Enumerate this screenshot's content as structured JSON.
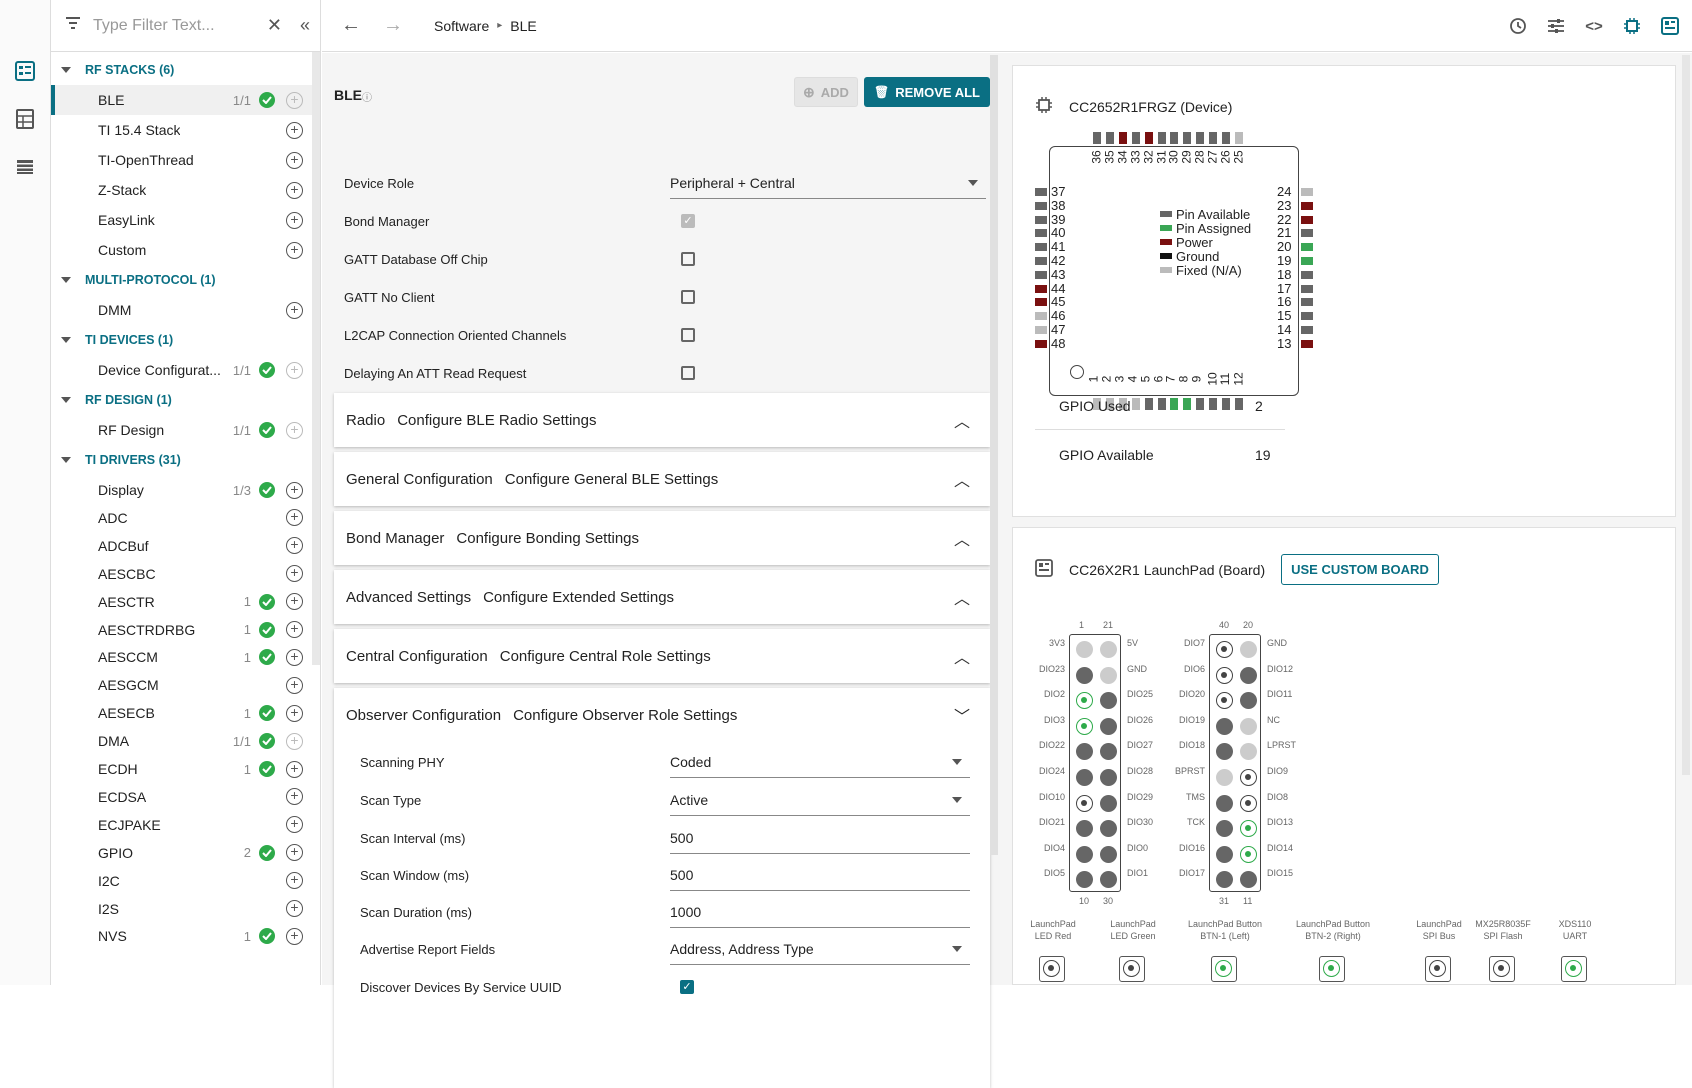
{
  "filter": {
    "placeholder": "Type Filter Text..."
  },
  "sidebar": {
    "categories": [
      {
        "label": "RF STACKS (6)"
      },
      {
        "label": "MULTI-PROTOCOL (1)"
      },
      {
        "label": "TI DEVICES (1)"
      },
      {
        "label": "RF DESIGN (1)"
      },
      {
        "label": "TI DRIVERS (31)"
      }
    ],
    "items": [
      {
        "label": "BLE",
        "count": "1/1"
      },
      {
        "label": "TI 15.4 Stack",
        "count": ""
      },
      {
        "label": "TI-OpenThread",
        "count": ""
      },
      {
        "label": "Z-Stack",
        "count": ""
      },
      {
        "label": "EasyLink",
        "count": ""
      },
      {
        "label": "Custom",
        "count": ""
      },
      {
        "label": "DMM",
        "count": ""
      },
      {
        "label": "Device Configurat...",
        "count": "1/1"
      },
      {
        "label": "RF Design",
        "count": "1/1"
      },
      {
        "label": "Display",
        "count": "1/3"
      },
      {
        "label": "ADC",
        "count": ""
      },
      {
        "label": "ADCBuf",
        "count": ""
      },
      {
        "label": "AESCBC",
        "count": ""
      },
      {
        "label": "AESCTR",
        "count": "1"
      },
      {
        "label": "AESCTRDRBG",
        "count": "1"
      },
      {
        "label": "AESCCM",
        "count": "1"
      },
      {
        "label": "AESGCM",
        "count": ""
      },
      {
        "label": "AESECB",
        "count": "1"
      },
      {
        "label": "DMA",
        "count": "1/1"
      },
      {
        "label": "ECDH",
        "count": "1"
      },
      {
        "label": "ECDSA",
        "count": ""
      },
      {
        "label": "ECJPAKE",
        "count": ""
      },
      {
        "label": "GPIO",
        "count": "2"
      },
      {
        "label": "I2C",
        "count": ""
      },
      {
        "label": "I2S",
        "count": ""
      },
      {
        "label": "NVS",
        "count": "1"
      }
    ]
  },
  "breadcrumb": {
    "part1": "Software",
    "part2": "BLE"
  },
  "panel": {
    "title": "BLE",
    "add_label": "ADD",
    "remove_all_label": "REMOVE ALL",
    "fields": {
      "device_role": {
        "label": "Device Role",
        "value": "Peripheral + Central"
      },
      "bond_manager": {
        "label": "Bond Manager"
      },
      "gatt_offchip": {
        "label": "GATT Database Off Chip"
      },
      "gatt_noclient": {
        "label": "GATT No Client"
      },
      "l2cap": {
        "label": "L2CAP Connection Oriented Channels"
      },
      "delaying": {
        "label": "Delaying An ATT Read Request"
      }
    },
    "sections": [
      {
        "title": "Radio",
        "desc": "Configure BLE Radio Settings"
      },
      {
        "title": "General Configuration",
        "desc": "Configure General BLE Settings"
      },
      {
        "title": "Bond Manager",
        "desc": "Configure Bonding Settings"
      },
      {
        "title": "Advanced Settings",
        "desc": "Configure Extended Settings"
      },
      {
        "title": "Central Configuration",
        "desc": "Configure Central Role Settings"
      },
      {
        "title": "Observer Configuration",
        "desc": "Configure Observer Role Settings"
      }
    ],
    "observer": {
      "scanning_phy": {
        "label": "Scanning PHY",
        "value": "Coded"
      },
      "scan_type": {
        "label": "Scan Type",
        "value": "Active"
      },
      "scan_interval": {
        "label": "Scan Interval (ms)",
        "value": "500"
      },
      "scan_window": {
        "label": "Scan Window (ms)",
        "value": "500"
      },
      "scan_duration": {
        "label": "Scan Duration (ms)",
        "value": "1000"
      },
      "adv_fields": {
        "label": "Advertise Report Fields",
        "value": "Address, Address Type"
      },
      "discover_uuid": {
        "label": "Discover Devices By Service UUID"
      }
    }
  },
  "device": {
    "title": "CC2652R1FRGZ (Device)",
    "legend": [
      "Pin Available",
      "Pin Assigned",
      "Power",
      "Ground",
      "Fixed (N/A)"
    ],
    "legend_colors": [
      "#666666",
      "#3aa655",
      "#7a1010",
      "#111111",
      "#bbbbbb"
    ],
    "gpio_used_label": "GPIO Used",
    "gpio_used": "2",
    "gpio_avail_label": "GPIO Available",
    "gpio_avail": "19",
    "pins_top": [
      "36",
      "35",
      "34",
      "33",
      "32",
      "31",
      "30",
      "29",
      "28",
      "27",
      "26",
      "25"
    ],
    "pins_left": [
      "37",
      "38",
      "39",
      "40",
      "41",
      "42",
      "43",
      "44",
      "45",
      "46",
      "47",
      "48"
    ],
    "pins_right": [
      "24",
      "23",
      "22",
      "21",
      "20",
      "19",
      "18",
      "17",
      "16",
      "15",
      "14",
      "13"
    ],
    "pins_bottom": [
      "1",
      "2",
      "3",
      "4",
      "5",
      "6",
      "7",
      "8",
      "9",
      "10",
      "11",
      "12"
    ]
  },
  "board": {
    "title": "CC26X2R1 LaunchPad (Board)",
    "custom_label": "USE CUSTOM BOARD",
    "h1_top": [
      "1",
      "21"
    ],
    "h1_bottom": [
      "10",
      "30"
    ],
    "h2_top": [
      "40",
      "20"
    ],
    "h2_bottom": [
      "31",
      "11"
    ],
    "h1_left": [
      "3V3",
      "DIO23",
      "DIO2",
      "DIO3",
      "DIO22",
      "DIO24",
      "DIO10",
      "DIO21",
      "DIO4",
      "DIO5"
    ],
    "h1_right": [
      "5V",
      "GND",
      "DIO25",
      "DIO26",
      "DIO27",
      "DIO28",
      "DIO29",
      "DIO30",
      "DIO0",
      "DIO1"
    ],
    "h2_left": [
      "DIO7",
      "DIO6",
      "DIO20",
      "DIO19",
      "DIO18",
      "BPRST",
      "TMS",
      "TCK",
      "DIO16",
      "DIO17"
    ],
    "h2_right": [
      "GND",
      "DIO12",
      "DIO11",
      "NC",
      "LPRST",
      "DIO9",
      "DIO8",
      "DIO13",
      "DIO14",
      "DIO15"
    ],
    "components": [
      {
        "l1": "LaunchPad",
        "l2": "LED Red"
      },
      {
        "l1": "LaunchPad",
        "l2": "LED Green"
      },
      {
        "l1": "LaunchPad Button",
        "l2": "BTN-1 (Left)"
      },
      {
        "l1": "LaunchPad Button",
        "l2": "BTN-2 (Right)"
      },
      {
        "l1": "LaunchPad",
        "l2": "SPI Bus"
      },
      {
        "l1": "MX25R8035F",
        "l2": "SPI Flash"
      },
      {
        "l1": "XDS110",
        "l2": "UART"
      }
    ]
  }
}
